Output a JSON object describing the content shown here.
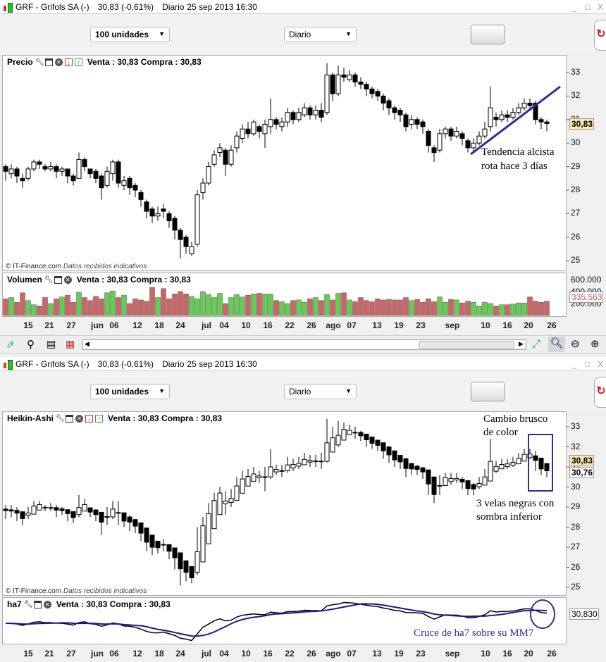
{
  "window": {
    "title": "GRF - Grifols SA (-)",
    "quote": "30,83 (-0,61%)",
    "period": "Diario",
    "datetime": "25 sep 2013 16:30",
    "min": "_",
    "max": "□",
    "close": "X"
  },
  "toolbar": {
    "units": "100 unidades",
    "interval": "Diario"
  },
  "price_panel": {
    "name": "Precio",
    "quote": "Venta : 30,83 Compra : 30,83",
    "axis": [
      "33",
      "32",
      "31",
      "30",
      "29",
      "28",
      "27",
      "26",
      "25"
    ],
    "last": "30,83",
    "copyright": "© IT-Finance.com",
    "disclaimer": "Datos recibidos indicativos"
  },
  "volume_panel": {
    "name": "Volumen",
    "quote": "Venta : 30,83 Compra : 30,83",
    "axis": [
      "600.000",
      "400.000",
      "200.000"
    ],
    "last": "335.563"
  },
  "ha_panel": {
    "name": "Heikin-Ashi",
    "quote": "Venta : 30,83 Compra : 30,83",
    "axis": [
      "33",
      "32",
      "31",
      "30",
      "29",
      "28",
      "27",
      "26",
      "25"
    ],
    "last": "30,83",
    "last2": "30,76",
    "copyright": "© IT-Finance.com",
    "disclaimer": "Datos recibidos indicativos"
  },
  "ha7_panel": {
    "name": "ha7",
    "quote": "Venta : 30,83 Compra : 30,83",
    "last": "30,830"
  },
  "dates": [
    "15",
    "21",
    "27",
    "jun",
    "06",
    "12",
    "18",
    "24",
    "jul",
    "04",
    "10",
    "16",
    "22",
    "26",
    "ago",
    "07",
    "13",
    "19",
    "23",
    "sep",
    "10",
    "16",
    "20",
    "26"
  ],
  "annotations": {
    "trend1": "Tendencia alcista",
    "trend2": "rota hace 3 días",
    "change1": "Cambio brusco",
    "change2": "de color",
    "black1": "3 velas negras con",
    "black2": "sombra inferior",
    "cross": "Cruce de ha7 sobre su MM7"
  },
  "colors": {
    "up": "#ffffff",
    "down": "#000000",
    "vol_up": "#66cc55",
    "vol_down": "#cc6666",
    "annotation": "#2e3192",
    "mm7": "#1a1a99",
    "price_tag": "#fde9a8"
  },
  "chart_data": {
    "type": "candlestick",
    "ylim": [
      24.6,
      33.6
    ],
    "candles": [
      [
        29.0,
        29.1,
        28.4,
        28.8
      ],
      [
        28.7,
        29.1,
        28.5,
        28.9
      ],
      [
        28.9,
        29.0,
        28.3,
        28.6
      ],
      [
        28.5,
        28.7,
        28.1,
        28.4
      ],
      [
        28.5,
        29.0,
        28.4,
        28.9
      ],
      [
        28.9,
        29.3,
        28.8,
        29.2
      ],
      [
        29.2,
        29.3,
        28.9,
        29.1
      ],
      [
        29.0,
        29.1,
        28.8,
        28.9
      ],
      [
        28.9,
        29.2,
        28.8,
        29.0
      ],
      [
        29.0,
        29.1,
        28.5,
        28.8
      ],
      [
        28.8,
        29.0,
        28.6,
        28.9
      ],
      [
        28.9,
        28.9,
        28.3,
        28.6
      ],
      [
        28.6,
        28.7,
        28.2,
        28.4
      ],
      [
        28.5,
        29.6,
        28.5,
        29.3
      ],
      [
        29.3,
        29.4,
        28.8,
        29.0
      ],
      [
        28.9,
        28.9,
        28.5,
        28.7
      ],
      [
        28.8,
        28.9,
        28.3,
        28.5
      ],
      [
        28.6,
        28.7,
        27.6,
        28.1
      ],
      [
        28.2,
        29.0,
        28.1,
        28.8
      ],
      [
        28.7,
        29.3,
        28.4,
        29.2
      ],
      [
        29.2,
        29.3,
        28.1,
        28.3
      ],
      [
        28.2,
        28.6,
        28.0,
        28.4
      ],
      [
        28.5,
        28.6,
        27.8,
        28.1
      ],
      [
        28.2,
        28.3,
        27.7,
        28.0
      ],
      [
        27.9,
        28.0,
        27.3,
        27.6
      ],
      [
        27.5,
        27.6,
        26.8,
        27.1
      ],
      [
        27.2,
        27.3,
        26.6,
        26.9
      ],
      [
        26.9,
        27.3,
        26.7,
        27.0
      ],
      [
        27.2,
        27.4,
        26.8,
        27.1
      ],
      [
        27.0,
        27.1,
        26.4,
        26.7
      ],
      [
        26.8,
        26.9,
        25.9,
        26.3
      ],
      [
        26.3,
        26.4,
        25.1,
        25.9
      ],
      [
        26.0,
        26.1,
        25.3,
        25.6
      ],
      [
        25.3,
        25.8,
        25.2,
        25.6
      ],
      [
        25.7,
        28.0,
        25.6,
        27.8
      ],
      [
        27.9,
        28.5,
        27.6,
        28.3
      ],
      [
        28.3,
        29.2,
        28.2,
        29.0
      ],
      [
        29.1,
        29.7,
        29.0,
        29.5
      ],
      [
        29.6,
        30.0,
        29.4,
        29.8
      ],
      [
        29.7,
        29.8,
        28.6,
        29.1
      ],
      [
        29.1,
        29.9,
        29.0,
        29.7
      ],
      [
        29.8,
        30.5,
        29.6,
        30.3
      ],
      [
        30.2,
        30.8,
        30.0,
        30.6
      ],
      [
        30.6,
        30.9,
        30.2,
        30.4
      ],
      [
        30.4,
        31.0,
        30.3,
        30.9
      ],
      [
        30.7,
        30.8,
        30.2,
        30.5
      ],
      [
        30.4,
        31.0,
        29.8,
        30.8
      ],
      [
        30.7,
        31.9,
        30.4,
        31.0
      ],
      [
        31.0,
        31.1,
        30.6,
        30.8
      ],
      [
        30.7,
        31.1,
        30.5,
        30.9
      ],
      [
        30.9,
        31.5,
        30.7,
        31.3
      ],
      [
        31.3,
        31.4,
        30.8,
        31.0
      ],
      [
        31.0,
        31.5,
        30.9,
        31.3
      ],
      [
        31.2,
        31.7,
        31.1,
        31.5
      ],
      [
        31.5,
        31.6,
        31.0,
        31.2
      ],
      [
        31.2,
        31.6,
        31.0,
        31.4
      ],
      [
        31.4,
        31.7,
        30.9,
        31.1
      ],
      [
        31.3,
        33.4,
        31.2,
        32.9
      ],
      [
        32.9,
        33.0,
        31.8,
        32.1
      ],
      [
        32.1,
        33.3,
        32.0,
        32.9
      ],
      [
        32.9,
        33.2,
        32.6,
        32.8
      ],
      [
        32.7,
        33.1,
        32.6,
        32.9
      ],
      [
        32.9,
        33.0,
        32.4,
        32.6
      ],
      [
        32.6,
        32.8,
        32.3,
        32.5
      ],
      [
        32.5,
        32.6,
        32.0,
        32.3
      ],
      [
        32.3,
        32.4,
        31.9,
        32.1
      ],
      [
        32.2,
        32.3,
        31.8,
        32.0
      ],
      [
        32.0,
        32.1,
        31.4,
        31.7
      ],
      [
        31.8,
        31.9,
        31.2,
        31.5
      ],
      [
        31.5,
        31.6,
        31.0,
        31.3
      ],
      [
        31.4,
        31.5,
        30.9,
        31.2
      ],
      [
        31.2,
        31.3,
        30.5,
        30.7
      ],
      [
        30.8,
        31.2,
        30.6,
        31.0
      ],
      [
        31.0,
        31.1,
        30.6,
        30.8
      ],
      [
        30.9,
        31.0,
        30.4,
        30.7
      ],
      [
        30.5,
        30.6,
        29.6,
        29.9
      ],
      [
        29.8,
        29.9,
        29.2,
        29.6
      ],
      [
        29.7,
        30.6,
        29.6,
        30.4
      ],
      [
        30.4,
        30.7,
        30.2,
        30.6
      ],
      [
        30.6,
        30.7,
        30.1,
        30.3
      ],
      [
        30.3,
        30.7,
        30.2,
        30.5
      ],
      [
        30.4,
        30.5,
        29.9,
        30.2
      ],
      [
        30.1,
        30.2,
        29.6,
        29.8
      ],
      [
        29.8,
        30.2,
        29.6,
        30.0
      ],
      [
        30.0,
        30.5,
        29.9,
        30.3
      ],
      [
        30.3,
        30.9,
        30.2,
        30.6
      ],
      [
        30.7,
        32.4,
        30.5,
        31.5
      ],
      [
        31.1,
        31.3,
        30.7,
        31.0
      ],
      [
        31.0,
        31.4,
        30.9,
        31.2
      ],
      [
        31.2,
        31.4,
        30.9,
        31.1
      ],
      [
        31.1,
        31.5,
        31.0,
        31.3
      ],
      [
        31.3,
        31.7,
        31.2,
        31.5
      ],
      [
        31.5,
        31.9,
        31.4,
        31.7
      ],
      [
        31.7,
        31.9,
        31.4,
        31.6
      ],
      [
        31.7,
        31.8,
        30.8,
        31.0
      ],
      [
        31.0,
        31.1,
        30.6,
        30.9
      ],
      [
        30.9,
        31.0,
        30.5,
        30.83
      ]
    ],
    "volume": [
      280,
      300,
      220,
      380,
      250,
      180,
      160,
      300,
      200,
      280,
      310,
      340,
      220,
      390,
      300,
      250,
      320,
      280,
      380,
      410,
      300,
      340,
      200,
      280,
      260,
      240,
      470,
      300,
      450,
      280,
      360,
      400,
      360,
      320,
      280,
      400,
      350,
      300,
      370,
      200,
      300,
      350,
      310,
      340,
      360,
      370,
      360,
      360,
      250,
      230,
      200,
      250,
      260,
      220,
      280,
      300,
      250,
      350,
      260,
      370,
      380,
      260,
      230,
      300,
      250,
      230,
      280,
      260,
      270,
      260,
      260,
      300,
      250,
      270,
      220,
      280,
      230,
      310,
      220,
      270,
      260,
      210,
      240,
      220,
      160,
      220,
      200,
      160,
      180,
      180,
      190,
      210,
      210,
      310,
      240,
      220,
      240
    ]
  }
}
